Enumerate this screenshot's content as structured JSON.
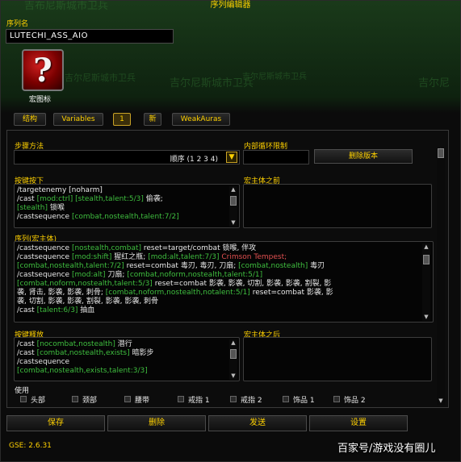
{
  "window": {
    "title": "序列编辑器"
  },
  "background_text": [
    "吉布尼斯城市卫兵",
    "吉尔尼斯城市卫兵",
    "吉尔尼",
    "吉尔尼斯城市卫兵",
    "吉尔尼斯城市卫兵"
  ],
  "sequence": {
    "name_label": "序列名",
    "name_value": "LUTECHI_ASS_AIO",
    "icon_label": "宏图标",
    "icon_glyph": "?"
  },
  "tabs": [
    "结构",
    "Variables",
    "1",
    "新",
    "WeakAuras"
  ],
  "active_tab": "1",
  "step": {
    "method_label": "步骤方法",
    "method_value": "顺序 (1 2 3 4)",
    "loop_limit_label": "内部循环限制",
    "delete_version_label": "删除版本"
  },
  "keypress": {
    "label": "按键按下",
    "lines": [
      [
        {
          "t": "/targetenemy [noharm]",
          "c": "w"
        }
      ],
      [
        {
          "t": "/cast ",
          "c": "w"
        },
        {
          "t": "[mod:ctrl] [stealth,talent:5/3]",
          "c": "g"
        },
        {
          "t": " 偷袭;",
          "c": "w"
        }
      ],
      [
        {
          "t": "[stealth]",
          "c": "g"
        },
        {
          "t": " 锁喉",
          "c": "w"
        }
      ],
      [
        {
          "t": "/castsequence ",
          "c": "w"
        },
        {
          "t": "[combat,nostealth,talent:7/2]",
          "c": "g"
        }
      ]
    ]
  },
  "premacro": {
    "label": "宏主体之前"
  },
  "sequence_body": {
    "label": "序列(宏主体)",
    "lines": [
      [
        {
          "t": "/castsequence ",
          "c": "w"
        },
        {
          "t": "[nostealth,combat]",
          "c": "g"
        },
        {
          "t": " reset=target/combat  锁喉, 伴攻",
          "c": "w"
        }
      ],
      [
        {
          "t": "/castsequence ",
          "c": "w"
        },
        {
          "t": "[mod:shift]",
          "c": "g"
        },
        {
          "t": " 猩红之瓶; ",
          "c": "w"
        },
        {
          "t": "[mod:alt,talent:7/3]",
          "c": "g"
        },
        {
          "t": " Crimson Tempest;",
          "c": "r"
        }
      ],
      [
        {
          "t": "[combat,nostealth,talent:7/2]",
          "c": "g"
        },
        {
          "t": " reset=combat  毒刃, 毒刃, 刀扇; ",
          "c": "w"
        },
        {
          "t": "[combat,nostealth]",
          "c": "g"
        },
        {
          "t": " 毒刃",
          "c": "w"
        }
      ],
      [
        {
          "t": "/castsequence ",
          "c": "w"
        },
        {
          "t": "[mod:alt]",
          "c": "g"
        },
        {
          "t": " 刀扇; ",
          "c": "w"
        },
        {
          "t": "[combat,noform,nostealth,talent:5/1]",
          "c": "g"
        }
      ],
      [
        {
          "t": "[combat,noform,nostealth,talent:5/3]",
          "c": "g"
        },
        {
          "t": " reset=combat  影袭, 影袭, 切割, 影袭, 影袭, 割裂, 影",
          "c": "w"
        }
      ],
      [
        {
          "t": "袭, 肾击, 影袭, 影袭, 刺骨; ",
          "c": "w"
        },
        {
          "t": "[combat,noform,nostealth,notalent:5/1]",
          "c": "g"
        },
        {
          "t": " reset=combat  影袭, 影",
          "c": "w"
        }
      ],
      [
        {
          "t": "袭, 切割, 影袭, 影袭, 割裂, 影袭, 影袭, 刺骨",
          "c": "w"
        }
      ],
      [
        {
          "t": "/cast ",
          "c": "w"
        },
        {
          "t": "[talent:6/3]",
          "c": "g"
        },
        {
          "t": " 抽血",
          "c": "w"
        }
      ]
    ]
  },
  "keyrelease": {
    "label": "按键释放",
    "lines": [
      [
        {
          "t": "/cast ",
          "c": "w"
        },
        {
          "t": "[nocombat,nostealth]",
          "c": "g"
        },
        {
          "t": " 潜行",
          "c": "w"
        }
      ],
      [
        {
          "t": "/cast ",
          "c": "w"
        },
        {
          "t": "[combat,nostealth,exists]",
          "c": "g"
        },
        {
          "t": " 暗影步",
          "c": "w"
        }
      ],
      [
        {
          "t": "/castsequence",
          "c": "w"
        }
      ],
      [
        {
          "t": "[combat,nostealth,exists,talent:3/3]",
          "c": "g"
        }
      ]
    ]
  },
  "postmacro": {
    "label": "宏主体之后"
  },
  "use": {
    "label": "使用",
    "items": [
      "头部",
      "颈部",
      "腰带",
      "戒指 1",
      "戒指 2",
      "饰品 1",
      "饰品 2"
    ]
  },
  "buttons": {
    "save": "保存",
    "delete": "删除",
    "send": "发送",
    "settings": "设置"
  },
  "version": "GSE: 2.6.31",
  "watermark": "百家号/游戏没有圈儿"
}
